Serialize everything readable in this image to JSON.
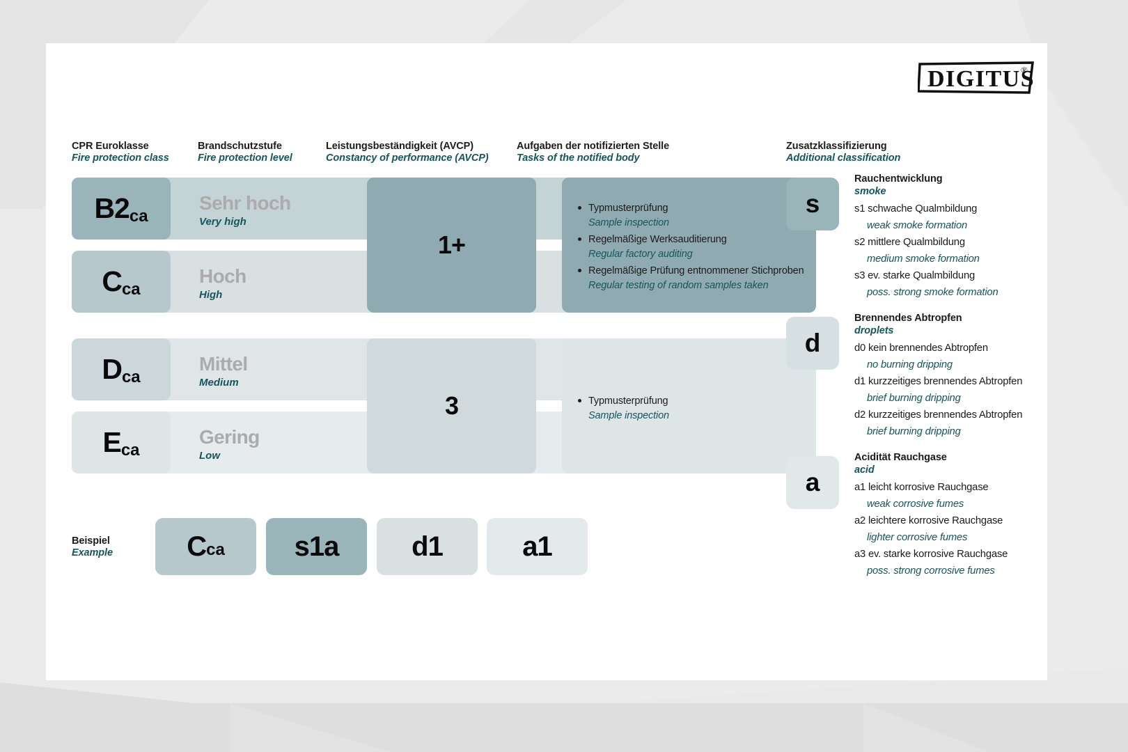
{
  "logo": {
    "text": "DIGITUS",
    "trademark": "®"
  },
  "columns": [
    {
      "de": "CPR Euroklasse",
      "en": "Fire protection class"
    },
    {
      "de": "Brandschutzstufe",
      "en": "Fire protection level"
    },
    {
      "de": "Leistungsbeständigkeit (AVCP)",
      "en": "Constancy of performance (AVCP)"
    },
    {
      "de": "Aufgaben der notifizierten Stelle",
      "en": "Tasks of the notified body"
    },
    {
      "de": "Zusatzklassifizierung",
      "en": "Additional classification"
    }
  ],
  "classes": [
    {
      "main": "B2",
      "sub": "ca",
      "level_de": "Sehr hoch",
      "level_en": "Very high"
    },
    {
      "main": "C",
      "sub": "ca",
      "level_de": "Hoch",
      "level_en": "High"
    },
    {
      "main": "D",
      "sub": "ca",
      "level_de": "Mittel",
      "level_en": "Medium"
    },
    {
      "main": "E",
      "sub": "ca",
      "level_de": "Gering",
      "level_en": "Low"
    }
  ],
  "avcp": [
    {
      "value": "1+"
    },
    {
      "value": "3"
    }
  ],
  "tasks": [
    {
      "items": [
        {
          "de": "Typmusterprüfung",
          "en": "Sample inspection"
        },
        {
          "de": "Regelmäßige Werksauditierung",
          "en": "Regular factory auditing"
        },
        {
          "de": "Regelmäßige Prüfung entnommener Stichproben",
          "en": "Regular testing of random samples taken"
        }
      ]
    },
    {
      "items": [
        {
          "de": "Typmusterprüfung",
          "en": "Sample inspection"
        }
      ]
    }
  ],
  "additional": [
    {
      "badge": "s",
      "title_de": "Rauchentwicklung",
      "title_en": "smoke",
      "rows": [
        {
          "de": "s1 schwache Qualmbildung",
          "en": "weak smoke formation"
        },
        {
          "de": "s2 mittlere Qualmbildung",
          "en": "medium smoke formation"
        },
        {
          "de": "s3 ev. starke Qualmbildung",
          "en": "poss. strong smoke formation"
        }
      ]
    },
    {
      "badge": "d",
      "title_de": "Brennendes Abtropfen",
      "title_en": "droplets",
      "rows": [
        {
          "de": "d0 kein brennendes Abtropfen",
          "en": "no burning dripping"
        },
        {
          "de": "d1 kurzzeitiges brennendes Abtropfen",
          "en": "brief burning dripping"
        },
        {
          "de": "d2 kurzzeitiges brennendes Abtropfen",
          "en": "brief burning dripping"
        }
      ]
    },
    {
      "badge": "a",
      "title_de": "Acidität Rauchgase",
      "title_en": "acid",
      "rows": [
        {
          "de": "a1 leicht korrosive Rauchgase",
          "en": "weak corrosive fumes"
        },
        {
          "de": "a2 leichtere korrosive Rauchgase",
          "en": "lighter corrosive fumes"
        },
        {
          "de": "a3 ev. starke korrosive Rauchgase",
          "en": "poss. strong corrosive fumes"
        }
      ]
    }
  ],
  "example": {
    "label_de": "Beispiel",
    "label_en": "Example",
    "chips": [
      {
        "main": "C",
        "sub": "ca"
      },
      {
        "main": "s1a",
        "sub": ""
      },
      {
        "main": "d1",
        "sub": ""
      },
      {
        "main": "a1",
        "sub": ""
      }
    ]
  },
  "colors": {
    "teal_text": "#15565c",
    "chip_dark": "#9ab5ba",
    "chip_mid": "#b6c8cc",
    "chip_light": "#cbd7da",
    "chip_lightest": "#dde5e7",
    "avcp_dark": "#8fabb1",
    "avcp_light": "#d0dadd",
    "level_gray": "#ababab",
    "page_bg": "#ebebeb",
    "sheet_bg": "#ffffff"
  }
}
